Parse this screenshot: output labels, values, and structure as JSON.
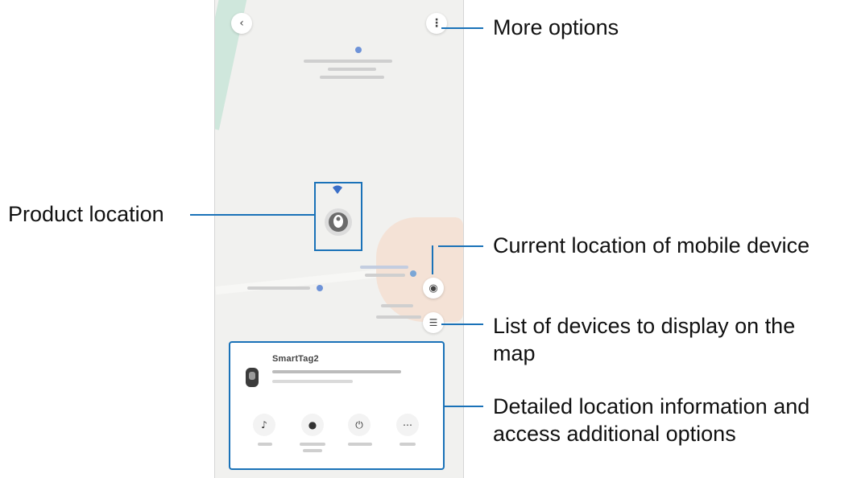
{
  "callouts": {
    "more_options": "More options",
    "product_location": "Product location",
    "current_location": "Current location of mobile device",
    "list_devices_line1": "List of devices to display on the",
    "list_devices_line2": "map",
    "detailed_line1": "Detailed location information and",
    "detailed_line2": "access additional options"
  },
  "card": {
    "device_name": "SmartTag2"
  },
  "colors": {
    "accent": "#1a72b8",
    "map_background": "#f1f1ef"
  },
  "icons": {
    "back": "back-icon",
    "more_options": "more-options-icon",
    "current_location": "current-location-icon",
    "device_list": "device-list-icon",
    "tag_marker": "tag-marker-icon",
    "ring": "ring-icon",
    "location_history": "location-history-icon",
    "connect": "connect-icon",
    "more": "more-icon"
  }
}
